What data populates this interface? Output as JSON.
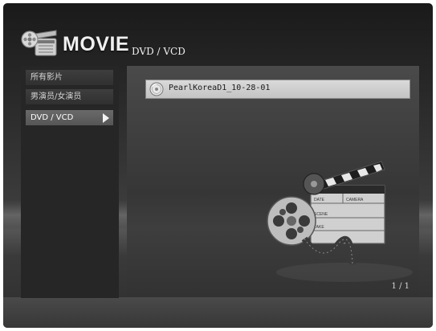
{
  "app": {
    "title": "MOVIE",
    "logo_icon": "film-reel-icon"
  },
  "header": {
    "section_title": "DVD / VCD"
  },
  "sidebar": {
    "items": [
      {
        "label": "所有影片",
        "selected": false
      },
      {
        "label": "男演员/女演员",
        "selected": false
      },
      {
        "label": "DVD / VCD",
        "selected": true,
        "icon": "arrow-right-icon"
      }
    ]
  },
  "file_list": {
    "items": [
      {
        "label": "PearlKoreaD1_10-28-01",
        "icon": "disc-icon",
        "selected": true
      }
    ],
    "page_indicator": "1 / 1"
  },
  "artwork": {
    "icon": "clapperboard-film-reel-icon",
    "labels": [
      "DATE",
      "CAMERA",
      "SCENE",
      "TAKE"
    ]
  },
  "colors": {
    "background": "#2a2a2a",
    "sidebar": "#262626",
    "selected_item": "#c8c8c8",
    "text": "#f0f0f0"
  }
}
